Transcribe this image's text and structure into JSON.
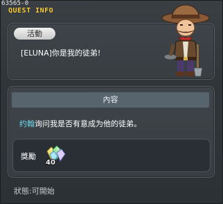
{
  "header": {
    "quest_id": "63565-0",
    "title": "QUEST INFO"
  },
  "quest": {
    "section_label": "活動",
    "text": "[ELUNA]你是我的徒弟!"
  },
  "content": {
    "header": "內容",
    "npc_name": "约翰",
    "dialog": "询问我是否有意成为他的徒弟。"
  },
  "reward": {
    "label": "獎勵",
    "item_icon": "crystal-gem-icon",
    "quantity": "40"
  },
  "status": {
    "label": "狀態",
    "separator": ":",
    "value": "可開始"
  },
  "npc": {
    "portrait": "cowboy-npc-portrait"
  },
  "colors": {
    "title": "#ffd23a",
    "npc_name": "#6fdcf0",
    "panel": "#3e4449",
    "content_header": "#58646d"
  }
}
